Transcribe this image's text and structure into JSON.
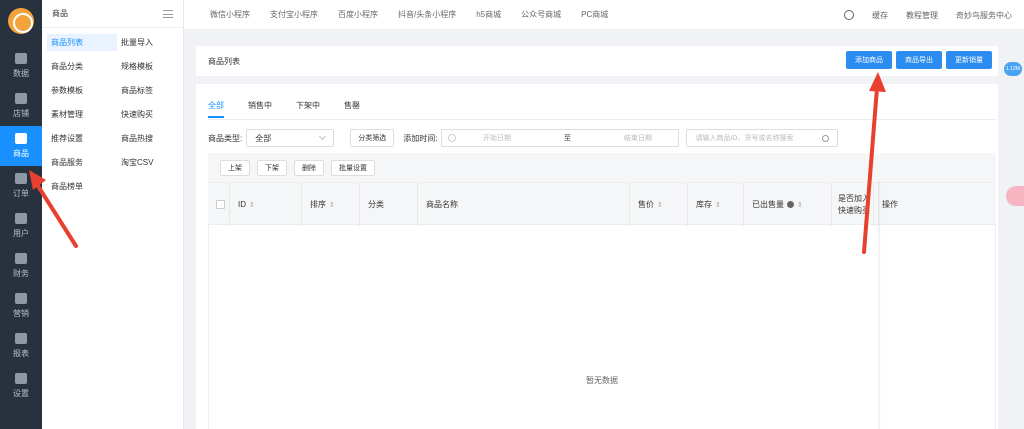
{
  "rail": {
    "items": [
      {
        "label": "数据",
        "icon": "chart-icon"
      },
      {
        "label": "店铺",
        "icon": "store-icon"
      },
      {
        "label": "商品",
        "icon": "bag-icon",
        "active": true
      },
      {
        "label": "订单",
        "icon": "order-icon"
      },
      {
        "label": "用户",
        "icon": "user-icon"
      },
      {
        "label": "财务",
        "icon": "finance-icon"
      },
      {
        "label": "营销",
        "icon": "grid-icon"
      },
      {
        "label": "报表",
        "icon": "report-icon"
      },
      {
        "label": "设置",
        "icon": "gear-icon"
      }
    ]
  },
  "submenu": {
    "title": "商品",
    "items": [
      "商品列表",
      "批量导入",
      "商品分类",
      "规格模板",
      "参数模板",
      "商品标签",
      "素材管理",
      "快速购买",
      "推荐设置",
      "商品热搜",
      "商品服务",
      "淘宝CSV",
      "商品榜单"
    ]
  },
  "topbar": {
    "tabs": [
      "微信小程序",
      "支付宝小程序",
      "百度小程序",
      "抖音/头条小程序",
      "h5商城",
      "公众号商城",
      "PC商城"
    ],
    "cache": "缓存",
    "tutorial": "教程管理",
    "service": "奇妙鸟服务中心"
  },
  "page": {
    "title": "商品列表",
    "buttons": [
      "添加商品",
      "商品导出",
      "更新销量"
    ]
  },
  "tabs": [
    "全部",
    "销售中",
    "下架中",
    "售罄"
  ],
  "filters": {
    "type_label": "商品类型:",
    "type_value": "全部",
    "category_button": "分类筛选",
    "time_label": "添加时间:",
    "start_placeholder": "开始日期",
    "range_sep": "至",
    "end_placeholder": "结束日期",
    "search_placeholder": "请输入商品ID、货号或名称搜索"
  },
  "toolbar": {
    "buttons": [
      "上架",
      "下架",
      "删除",
      "批量设置"
    ]
  },
  "table": {
    "columns": [
      "ID",
      "排序",
      "分类",
      "商品名称",
      "售价",
      "库存",
      "已出售量",
      "是否加入快速购买",
      "操作"
    ],
    "empty": "暂无数据"
  },
  "float_badge": "1.12M",
  "accent": "#1890ff",
  "annotation_color": "#e8402e"
}
